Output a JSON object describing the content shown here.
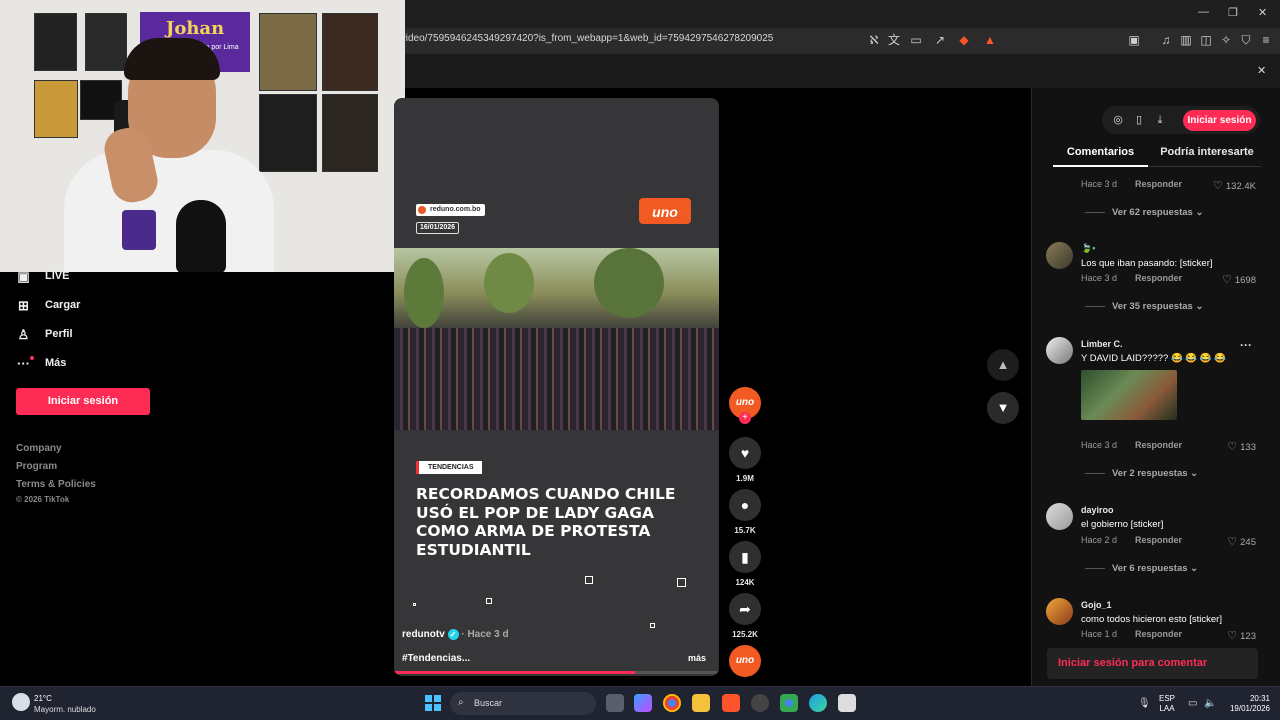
{
  "browser": {
    "url": "/video/7595946245349297420?is_from_webapp=1&web_id=7594297546278209025",
    "window_controls": [
      "—",
      "❐",
      "✕"
    ],
    "close_glyph": "✕",
    "toolbar_icons": [
      "translate-off-icon",
      "translate-icon",
      "cast-icon",
      "share-icon",
      "brave-shield-icon",
      "rewards-icon",
      "screenshot-icon",
      "music-icon",
      "sidebar-icon",
      "wallet-icon",
      "leo-ai-icon",
      "vpn-icon",
      "menu-icon"
    ]
  },
  "webcam": {
    "poster_title": "Johan",
    "poster_subtitle": "Diputado por Lima"
  },
  "sidebar": {
    "items": [
      {
        "label": "LIVE",
        "icon": "live-icon",
        "glyph": "▣"
      },
      {
        "label": "Cargar",
        "icon": "upload-icon",
        "glyph": "⊞"
      },
      {
        "label": "Perfil",
        "icon": "profile-icon",
        "glyph": "♙"
      },
      {
        "label": "Más",
        "icon": "more-icon",
        "glyph": "···"
      }
    ],
    "login_button": "Iniciar sesión",
    "footer": [
      "Company",
      "Program",
      "Terms & Policies",
      "© 2026 TikTok"
    ]
  },
  "video": {
    "site": "reduno.com.bo",
    "date": "16/01/2026",
    "logo_text": "uno",
    "tag": "TENDENCIAS",
    "headline": "RECORDAMOS CUANDO CHILE USÓ EL POP DE LADY GAGA COMO ARMA DE PROTESTA ESTUDIANTIL",
    "author": "redunotv",
    "posted": "· Hace 3 d",
    "hashtag": "#Tendencias...",
    "more": "más",
    "progress": 0.74
  },
  "actions": {
    "likes": "1.9M",
    "comments": "15.7K",
    "saves": "124K",
    "shares": "125.2K",
    "follow_glyph": "+"
  },
  "panel": {
    "login_button": "Iniciar sesión",
    "tabs": [
      "Comentarios",
      "Podría interesarte"
    ],
    "comments": [
      {
        "user": "",
        "text": "",
        "time": "Hace 3 d",
        "reply": "Responder",
        "likes": "132.4K",
        "replies": "Ver 62 respuestas"
      },
      {
        "user": "🍃•",
        "text": "Los que iban pasando: [sticker]",
        "time": "Hace 3 d",
        "reply": "Responder",
        "likes": "1698",
        "replies": "Ver 35 respuestas"
      },
      {
        "user": "Limber C.",
        "text": "Y DAVID LAID????? 😂 😂 😂 😂",
        "time": "Hace 3 d",
        "reply": "Responder",
        "likes": "133",
        "replies": "Ver 2 respuestas"
      },
      {
        "user": "dayiroo",
        "text": "el gobierno [sticker]",
        "time": "Hace 2 d",
        "reply": "Responder",
        "likes": "245",
        "replies": "Ver 6 respuestas"
      },
      {
        "user": "Gojo_1",
        "text": "como todos hicieron esto [sticker]",
        "time": "Hace 1 d",
        "reply": "Responder",
        "likes": "123",
        "replies": ""
      }
    ],
    "comment_login": "Iniciar sesión para comentar",
    "kebab": "···"
  },
  "taskbar": {
    "temperature": "21°C",
    "weather": "Mayorm. nublado",
    "search": "Buscar",
    "lang_top": "ESP",
    "lang_bottom": "LAA",
    "time": "20:31",
    "date": "19/01/2026"
  },
  "colors": {
    "accent": "#fe2c55",
    "uno": "#f15a22",
    "verified": "#20d5ec"
  }
}
